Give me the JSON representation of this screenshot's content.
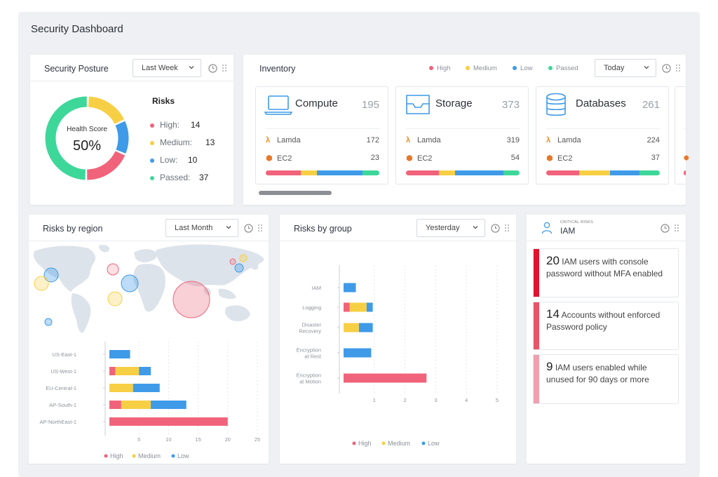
{
  "page": {
    "title": "Security Dashboard"
  },
  "colors": {
    "high": "#f0637a",
    "medium": "#f7cf45",
    "low": "#3f9ae8",
    "passed": "#3ed79a",
    "bg": "#eef0f3"
  },
  "posture": {
    "title": "Security Posture",
    "range": "Last Week",
    "health_label": "Health Score",
    "health_value": "50%",
    "risks_title": "Risks",
    "risks": [
      {
        "label": "High:",
        "value": "14"
      },
      {
        "label": "Medium:",
        "value": "13"
      },
      {
        "label": "Low:",
        "value": "10"
      },
      {
        "label": "Passed:",
        "value": "37"
      }
    ]
  },
  "inventory": {
    "title": "Inventory",
    "range": "Today",
    "legend": [
      "High",
      "Medium",
      "Low",
      "Passed"
    ],
    "cards": [
      {
        "name": "Compute",
        "count": "195",
        "icon": "laptop-icon",
        "rows": [
          {
            "label": "Lamda",
            "value": "172",
            "icon": "lambda-icon"
          },
          {
            "label": "EC2",
            "value": "23",
            "icon": "ec2-icon"
          }
        ],
        "split": [
          0.31,
          0.14,
          0.4,
          0.15
        ]
      },
      {
        "name": "Storage",
        "count": "373",
        "icon": "storage-tray-icon",
        "rows": [
          {
            "label": "Lamda",
            "value": "319",
            "icon": "lambda-icon"
          },
          {
            "label": "EC2",
            "value": "54",
            "icon": "ec2-icon"
          }
        ],
        "split": [
          0.29,
          0.14,
          0.43,
          0.14
        ]
      },
      {
        "name": "Databases",
        "count": "261",
        "icon": "database-icon",
        "rows": [
          {
            "label": "Lamda",
            "value": "224",
            "icon": "lambda-icon"
          },
          {
            "label": "EC2",
            "value": "37",
            "icon": "ec2-icon"
          }
        ],
        "split": [
          0.29,
          0.27,
          0.26,
          0.18
        ]
      }
    ]
  },
  "region": {
    "title": "Risks by region",
    "range": "Last Month",
    "legend": [
      "High",
      "Medium",
      "Low"
    ]
  },
  "group": {
    "title": "Risks by group",
    "range": "Yesterday",
    "legend": [
      "High",
      "Medium",
      "Low"
    ]
  },
  "critical": {
    "caption": "CRITICAL RISKS",
    "title": "IAM",
    "items": [
      {
        "count": "20",
        "text": "IAM users with console password without MFA enabled",
        "stripe": "#e2132d"
      },
      {
        "count": "14",
        "text": "Accounts without enforced Password policy",
        "stripe": "#e8546a"
      },
      {
        "count": "9",
        "text": "IAM users enabled while unused for 90 days or more",
        "stripe": "#f0a0ad"
      }
    ]
  },
  "chart_data": [
    {
      "type": "pie",
      "categories": [
        "High",
        "Medium",
        "Low",
        "Passed"
      ],
      "values": [
        14,
        13,
        10,
        37
      ],
      "donut": true,
      "center_text": "Health Score 50%"
    },
    {
      "type": "bar",
      "orientation": "horizontal",
      "stacked": true,
      "categories": [
        "US-East-1",
        "US-West-1",
        "EU-Central-1",
        "AP-South-1",
        "AP-NorthEast-1"
      ],
      "series": [
        {
          "name": "High",
          "values": [
            0,
            1,
            0,
            2,
            20
          ]
        },
        {
          "name": "Medium",
          "values": [
            0,
            4,
            4,
            5,
            0
          ]
        },
        {
          "name": "Low",
          "values": [
            3.5,
            2,
            4.5,
            6,
            0
          ]
        }
      ],
      "xticks": [
        5,
        10,
        15,
        20,
        25
      ],
      "xlim": [
        0,
        25
      ],
      "legend": "bottom"
    },
    {
      "type": "bar",
      "orientation": "horizontal",
      "stacked": true,
      "categories": [
        "IAM",
        "Logging",
        "Disaster Recovery",
        "Encryption at Rest",
        "Encryption at Motion"
      ],
      "series": [
        {
          "name": "High",
          "values": [
            0,
            0.2,
            0,
            0,
            2.7
          ]
        },
        {
          "name": "Medium",
          "values": [
            0,
            0.55,
            0.5,
            0,
            0
          ]
        },
        {
          "name": "Low",
          "values": [
            0.4,
            0.2,
            0.45,
            0.9,
            0
          ]
        }
      ],
      "xticks": [
        1,
        2,
        3,
        4,
        5
      ],
      "xlim": [
        0,
        5
      ],
      "legend": "bottom"
    }
  ]
}
